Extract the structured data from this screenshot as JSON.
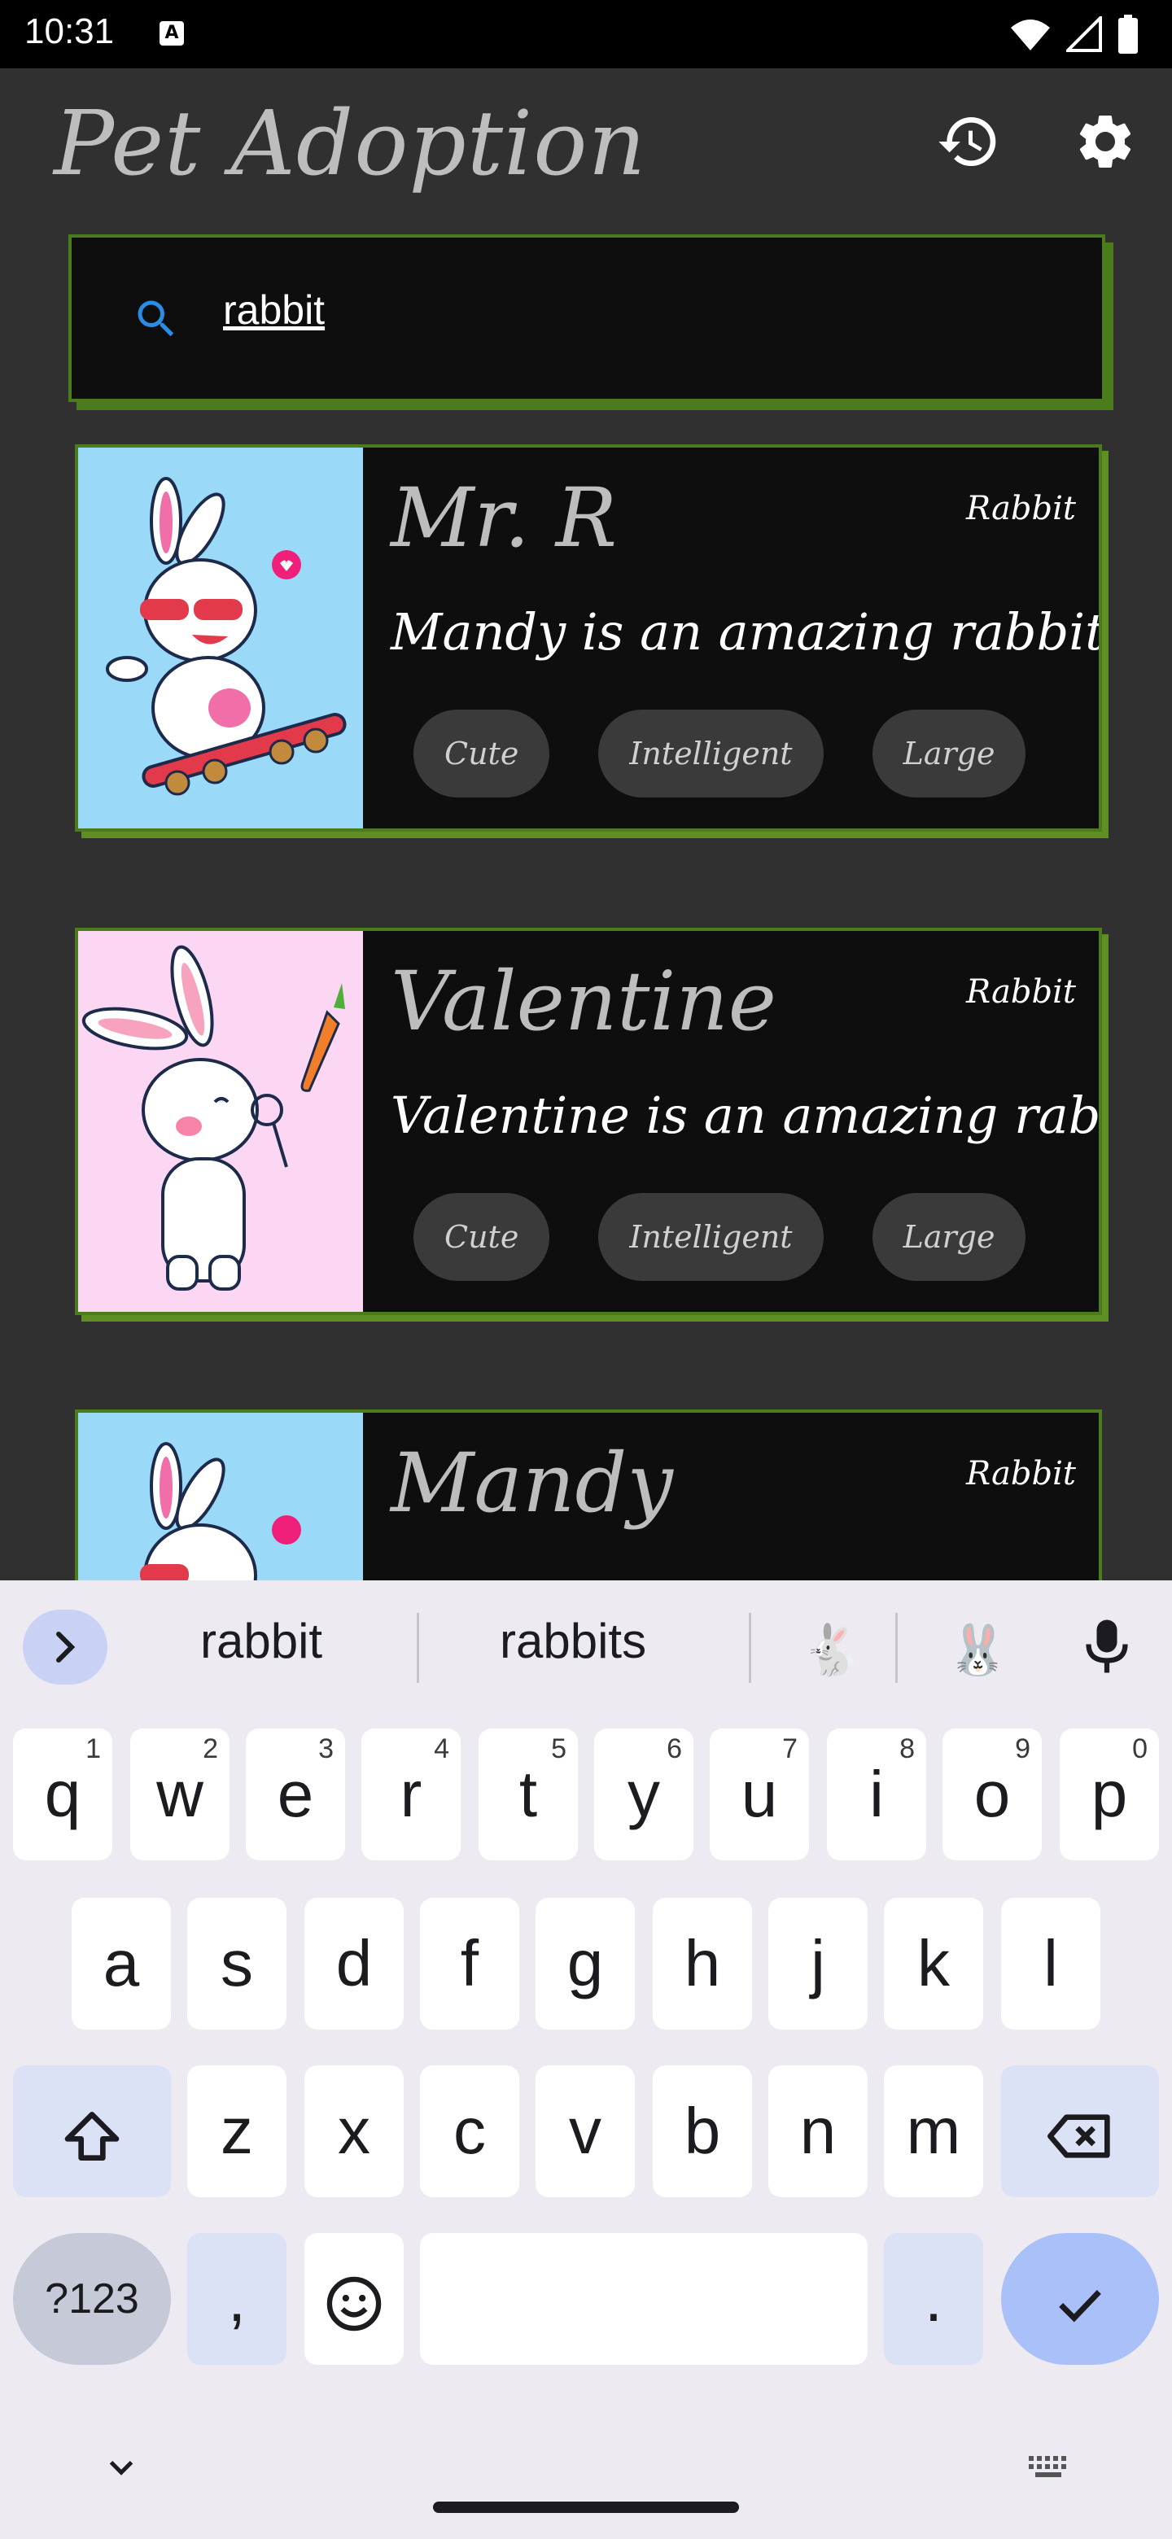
{
  "status": {
    "time": "10:31",
    "a_icon": "A"
  },
  "app": {
    "title": "Pet Adoption"
  },
  "search": {
    "value": "rabbit"
  },
  "pets": [
    {
      "name": "Mr. R",
      "type": "Rabbit",
      "description": "Mandy is an amazing rabbit",
      "tags": [
        "Cute",
        "Intelligent",
        "Large"
      ],
      "image_bg": "#9ad9f7"
    },
    {
      "name": "Valentine",
      "type": "Rabbit",
      "description": "Valentine is an amazing rabbit",
      "tags": [
        "Cute",
        "Intelligent",
        "Large"
      ],
      "image_bg": "#fbd7f4"
    },
    {
      "name": "Mandy",
      "type": "Rabbit",
      "description": "",
      "tags": [],
      "image_bg": "#9ad9f7"
    }
  ],
  "keyboard": {
    "suggestions": [
      "rabbit",
      "rabbits"
    ],
    "emoji_suggestions": [
      "🐇",
      "🐰"
    ],
    "row1": [
      "q",
      "w",
      "e",
      "r",
      "t",
      "y",
      "u",
      "i",
      "o",
      "p"
    ],
    "row1_nums": [
      "1",
      "2",
      "3",
      "4",
      "5",
      "6",
      "7",
      "8",
      "9",
      "0"
    ],
    "row2": [
      "a",
      "s",
      "d",
      "f",
      "g",
      "h",
      "j",
      "k",
      "l"
    ],
    "row3": [
      "z",
      "x",
      "c",
      "v",
      "b",
      "n",
      "m"
    ],
    "symbols_label": "?123",
    "comma": ",",
    "period": "."
  },
  "colors": {
    "accent_green": "#4a7c1d",
    "card_bg": "#0e0e0e",
    "page_bg": "#303030"
  }
}
